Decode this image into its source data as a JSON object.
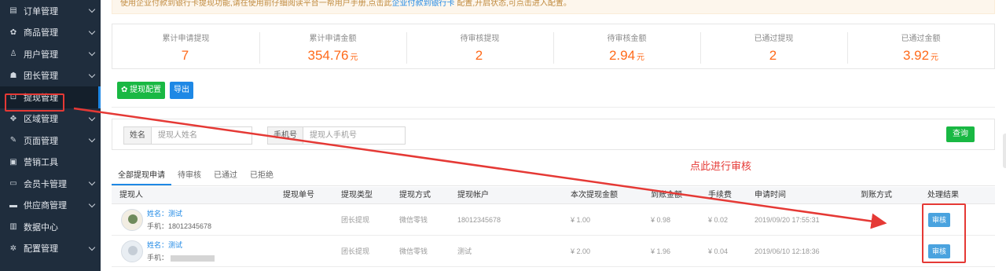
{
  "sidebar": {
    "items": [
      {
        "label": "订单管理",
        "icon": "order-icon",
        "glyph": "▤",
        "chevron": true
      },
      {
        "label": "商品管理",
        "icon": "goods-icon",
        "glyph": "✿",
        "chevron": true
      },
      {
        "label": "用户管理",
        "icon": "user-icon",
        "glyph": "♙",
        "chevron": true
      },
      {
        "label": "团长管理",
        "icon": "team-icon",
        "glyph": "☗",
        "chevron": true
      },
      {
        "label": "提现管理",
        "icon": "withdraw-icon",
        "glyph": "⊡",
        "chevron": false
      },
      {
        "label": "区域管理",
        "icon": "region-icon",
        "glyph": "✥",
        "chevron": true
      },
      {
        "label": "页面管理",
        "icon": "page-icon",
        "glyph": "✎",
        "chevron": true
      },
      {
        "label": "营销工具",
        "icon": "marketing-icon",
        "glyph": "▣",
        "chevron": false
      },
      {
        "label": "会员卡管理",
        "icon": "card-icon",
        "glyph": "▭",
        "chevron": true
      },
      {
        "label": "供应商管理",
        "icon": "supplier-icon",
        "glyph": "▬",
        "chevron": true
      },
      {
        "label": "数据中心",
        "icon": "chart-icon",
        "glyph": "▥",
        "chevron": false
      },
      {
        "label": "配置管理",
        "icon": "settings-icon",
        "glyph": "✲",
        "chevron": true
      }
    ]
  },
  "notice": {
    "text": "使用企业付款到银行卡提现功能,请在使用前仔细阅读平台一帮用户手册,点击此",
    "link": "企业付款到银行卡",
    "suffix": " 配置,开启状态,可点击进入配置。"
  },
  "stats": [
    {
      "label": "累计申请提现",
      "value": "7",
      "unit": ""
    },
    {
      "label": "累计申请金额",
      "value": "354.76",
      "unit": "元"
    },
    {
      "label": "待审核提现",
      "value": "2",
      "unit": ""
    },
    {
      "label": "待审核金额",
      "value": "2.94",
      "unit": "元"
    },
    {
      "label": "已通过提现",
      "value": "2",
      "unit": ""
    },
    {
      "label": "已通过金额",
      "value": "3.92",
      "unit": "元"
    }
  ],
  "toolbar": {
    "config_label": "✿ 提现配置",
    "export_label": "导出"
  },
  "filter": {
    "name_label": "姓名",
    "name_placeholder": "提现人姓名",
    "phone_label": "手机号",
    "phone_placeholder": "提现人手机号",
    "query_label": "查询"
  },
  "annotation": "点此进行审核",
  "tabs": [
    "全部提现申请",
    "待审核",
    "已通过",
    "已拒绝"
  ],
  "table": {
    "headers": [
      "提现人",
      "提现单号",
      "提现类型",
      "提现方式",
      "提现帐户",
      "本次提现金额",
      "到账金额",
      "手续费",
      "申请时间",
      "到账方式",
      "处理结果"
    ],
    "rows": [
      {
        "name": "姓名：测试",
        "phone": "手机：18012345678",
        "order_no": "",
        "type": "团长提现",
        "method": "微信零钱",
        "account": "18012345678",
        "amount": "¥ 1.00",
        "received": "¥ 0.98",
        "fee": "¥ 0.02",
        "time": "2019/09/20 17:55:31",
        "arrival": "",
        "action": "审核"
      },
      {
        "name": "姓名：测试",
        "phone": "手机：",
        "order_no": "",
        "type": "团长提现",
        "method": "微信零钱",
        "account": "测试",
        "amount": "¥ 2.00",
        "received": "¥ 1.96",
        "fee": "¥ 0.04",
        "time": "2019/06/10 12:18:36",
        "arrival": "",
        "action": "审核"
      }
    ]
  },
  "colors": {
    "sidebar_bg": "#1f2d3d",
    "accent_orange": "#ff6a1a",
    "btn_green": "#19b843",
    "btn_blue": "#1e88e5",
    "annotation_red": "#e53935"
  }
}
